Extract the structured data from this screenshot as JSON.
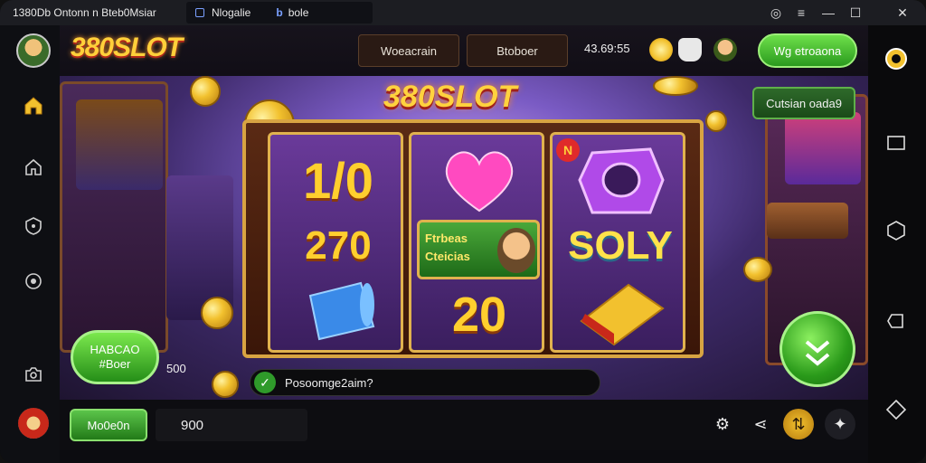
{
  "window": {
    "tab1_title": "1380Db Ontonn n Bteb0Msiar",
    "tab2_title": "Nlogalie",
    "tab2_extra": "bole",
    "controls": {
      "target": "◎",
      "menu": "≡",
      "minimize": "—",
      "maximize": "☐",
      "close": "✕"
    }
  },
  "header": {
    "brand": "380SLOT",
    "box1": "Woeacrain",
    "box2": "Btoboer",
    "timer": "43.69:55",
    "cta": "Wg etroaona"
  },
  "game": {
    "logo": "380SLOT",
    "top_right_label": "Cutsian oada9",
    "reel1": {
      "line1": "1/0",
      "line2": "270"
    },
    "reel2": {
      "banner_l1": "Ftrbeas",
      "banner_l2": "Cteicias",
      "value": "20"
    },
    "reel3": {
      "badge": "N",
      "word": "SOLY"
    },
    "spin_left_l1": "HABCAO",
    "spin_left_l2": "#Boer",
    "bet_left": "500",
    "status_text": "Posoomge2aim?"
  },
  "bottom": {
    "mode_button": "Mo0e0n",
    "credits": "900"
  },
  "colors": {
    "accent_green": "#3fb52e",
    "gold": "#ffd03a"
  }
}
